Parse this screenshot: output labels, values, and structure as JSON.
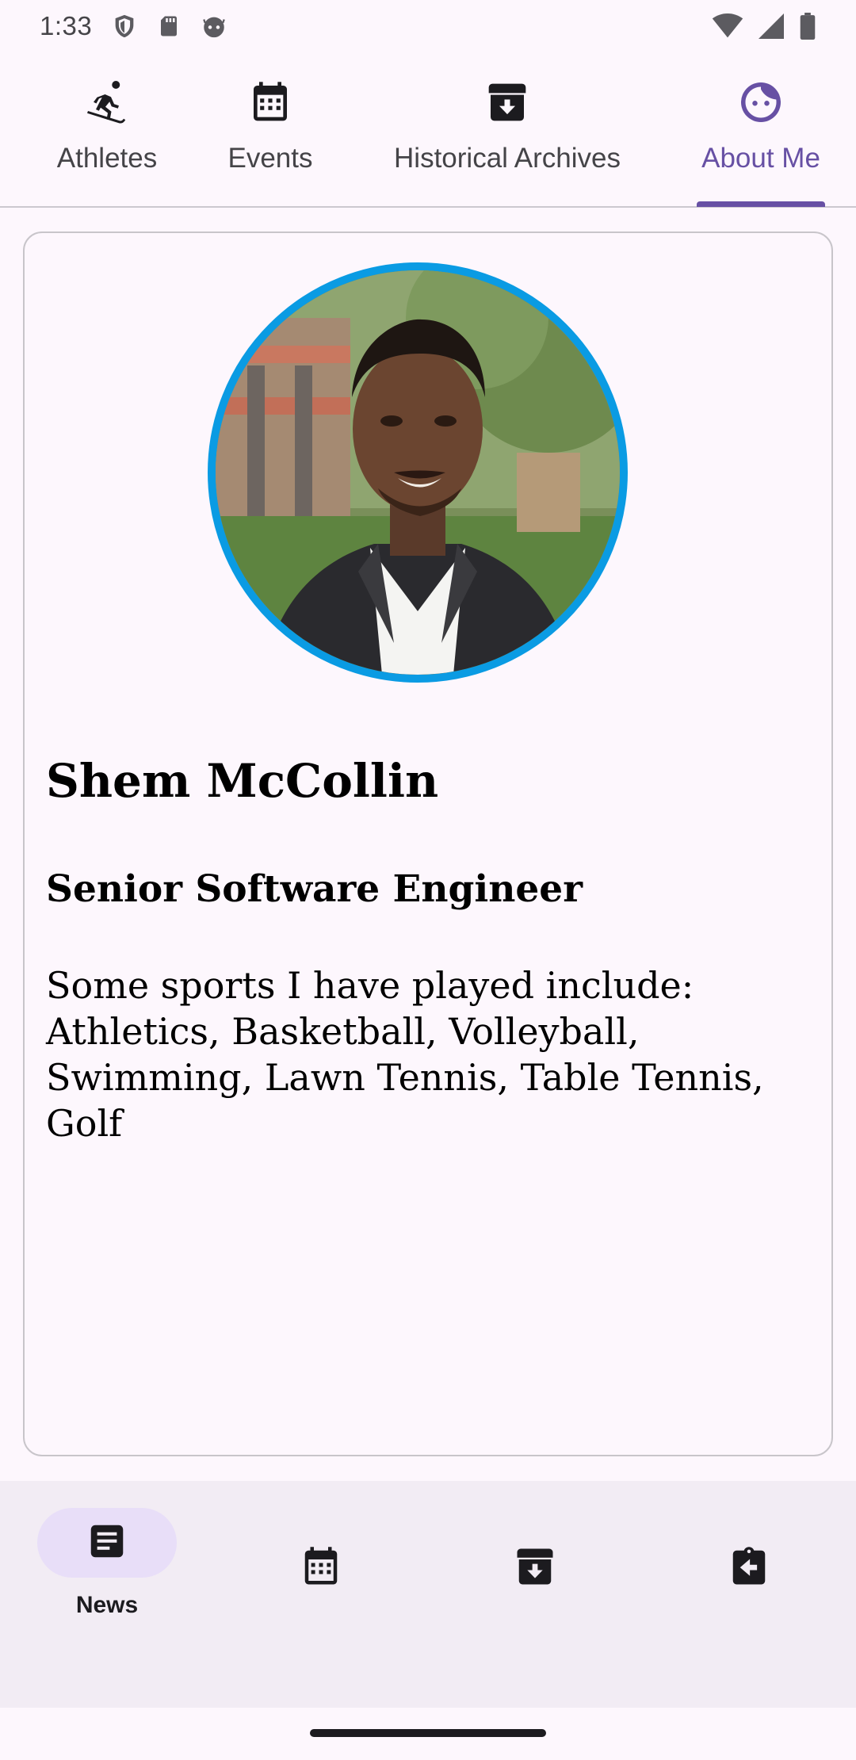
{
  "status_bar": {
    "time": "1:33",
    "left_icons": [
      "shield-icon",
      "sd-card-icon",
      "android-face-icon"
    ],
    "right_icons": [
      "wifi-icon",
      "signal-icon",
      "battery-icon"
    ]
  },
  "top_tabs": [
    {
      "label": "Athletes",
      "icon": "skiing-person-icon",
      "active": false
    },
    {
      "label": "Events",
      "icon": "calendar-icon",
      "active": false
    },
    {
      "label": "Historical Archives",
      "icon": "archive-icon",
      "active": false
    },
    {
      "label": "About Me",
      "icon": "face-icon",
      "active": true
    }
  ],
  "profile": {
    "name": "Shem McCollin",
    "title": "Senior Software Engineer",
    "bio": "Some sports I have played include: Athletics, Basketball, Volleyball, Swimming, Lawn Tennis, Table Tennis, Golf",
    "avatar_ring_color": "#0A9BE3"
  },
  "bottom_nav": [
    {
      "label": "News",
      "icon": "article-icon",
      "active": true
    },
    {
      "label": "",
      "icon": "calendar-icon",
      "active": false
    },
    {
      "label": "",
      "icon": "archive-icon",
      "active": false
    },
    {
      "label": "",
      "icon": "assignment-return-icon",
      "active": false
    }
  ],
  "colors": {
    "accent": "#6750A4",
    "background": "#FDF7FD",
    "nav_background": "#F2ECF4",
    "active_pill": "#E8DEF8"
  }
}
